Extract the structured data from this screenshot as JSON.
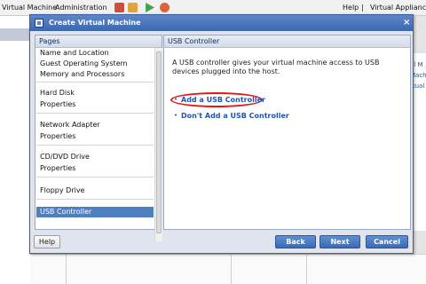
{
  "app": {
    "menu_left": "Virtual Machine",
    "menu_admin": "Administration",
    "menu_help": "Help",
    "menu_separator": "|",
    "menu_right": "Virtual Appliance",
    "side_links": [
      "al M",
      "Mach",
      "rtual"
    ]
  },
  "dialog": {
    "title": "Create Virtual Machine",
    "close": "×"
  },
  "pages": {
    "header": "Pages",
    "items": [
      "Name and Location",
      "Guest Operating System",
      "Memory and Processors",
      "Hard Disk",
      "Properties",
      "Network Adapter",
      "Properties",
      "CD/DVD Drive",
      "Properties",
      "Floppy Drive",
      "USB Controller"
    ],
    "selected": "USB Controller"
  },
  "content": {
    "header": "USB Controller",
    "description": "A USB controller gives your virtual machine access to USB devices plugged into the host.",
    "options": [
      {
        "label": "Add a USB Controller",
        "selected": true
      },
      {
        "label": "Don't Add a USB Controller",
        "selected": false
      }
    ],
    "bullet": "•"
  },
  "footer": {
    "help": "Help",
    "back": "Back",
    "next": "Next",
    "cancel": "Cancel"
  },
  "colors": {
    "accent": "#3c67b0",
    "link": "#1c55b7",
    "selection": "#4e7fc1",
    "annotation": "#e01818"
  }
}
